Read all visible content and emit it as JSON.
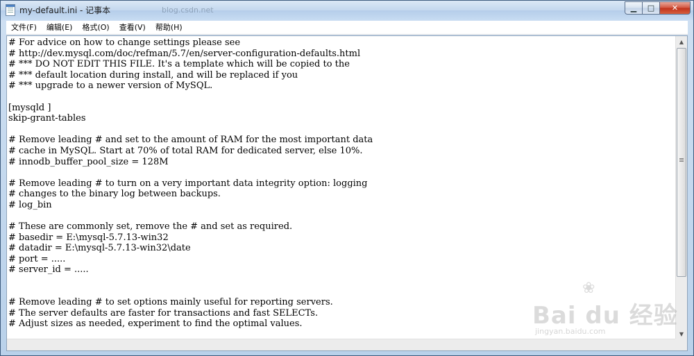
{
  "window": {
    "title": "my-default.ini - 记事本",
    "background_url": "blog.csdn.net"
  },
  "caption_buttons": {
    "minimize": "▁",
    "maximize": "□",
    "close": "✕"
  },
  "menu": [
    {
      "label": "文件(F)"
    },
    {
      "label": "编辑(E)"
    },
    {
      "label": "格式(O)"
    },
    {
      "label": "查看(V)"
    },
    {
      "label": "帮助(H)"
    }
  ],
  "document": {
    "lines": [
      "# For advice on how to change settings please see",
      "# http://dev.mysql.com/doc/refman/5.7/en/server-configuration-defaults.html",
      "# *** DO NOT EDIT THIS FILE. It's a template which will be copied to the",
      "# *** default location during install, and will be replaced if you",
      "# *** upgrade to a newer version of MySQL.",
      "",
      "[mysqld ]",
      "skip-grant-tables",
      "",
      "# Remove leading # and set to the amount of RAM for the most important data",
      "# cache in MySQL. Start at 70% of total RAM for dedicated server, else 10%.",
      "# innodb_buffer_pool_size = 128M",
      "",
      "# Remove leading # to turn on a very important data integrity option: logging",
      "# changes to the binary log between backups.",
      "# log_bin",
      "",
      "# These are commonly set, remove the # and set as required.",
      "# basedir = E:\\mysql-5.7.13-win32",
      "# datadir = E:\\mysql-5.7.13-win32\\date",
      "# port = .....",
      "# server_id = .....",
      "",
      "",
      "# Remove leading # to set options mainly useful for reporting servers.",
      "# The server defaults are faster for transactions and fast SELECTs.",
      "# Adjust sizes as needed, experiment to find the optimal values."
    ]
  },
  "watermark": {
    "logo": "Bai  du 经验",
    "paw": "❀",
    "url": "jingyan.baidu.com"
  },
  "icons": {
    "app": "notepad-icon",
    "scroll_up": "▲",
    "scroll_down": "▼"
  }
}
